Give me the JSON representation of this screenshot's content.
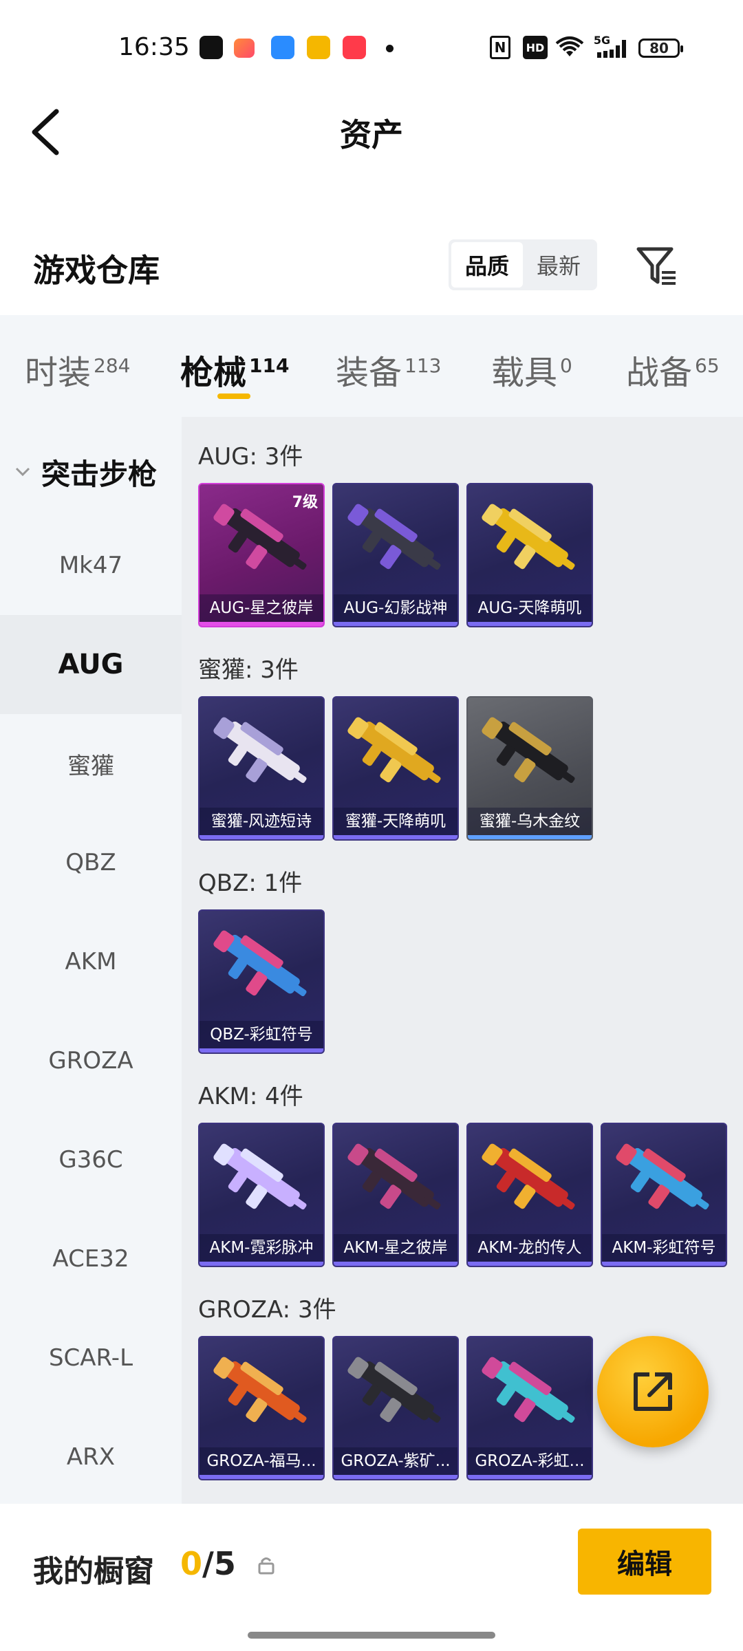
{
  "status_bar": {
    "time": "16:35",
    "network": "5G",
    "hd": "HD",
    "nfc": "N",
    "battery": "80"
  },
  "header": {
    "title": "资产",
    "back_icon": "back-arrow-icon"
  },
  "warehouse": {
    "title": "游戏仓库",
    "sort_options": [
      "品质",
      "最新"
    ],
    "sort_selected": "品质",
    "filter_icon": "filter-icon"
  },
  "tabs": [
    {
      "label": "时装",
      "count": "284"
    },
    {
      "label": "枪械",
      "count": "114"
    },
    {
      "label": "装备",
      "count": "113"
    },
    {
      "label": "载具",
      "count": "0"
    },
    {
      "label": "战备",
      "count": "65"
    }
  ],
  "active_tab": "枪械",
  "sidebar": {
    "category": "突击步枪",
    "items": [
      "Mk47",
      "AUG",
      "蜜獾",
      "QBZ",
      "AKM",
      "GROZA",
      "G36C",
      "ACE32",
      "SCAR-L",
      "ARX"
    ],
    "selected": "AUG"
  },
  "groups": [
    {
      "title": "AUG: 3件",
      "items": [
        {
          "label": "AUG-星之彼岸",
          "level": "7级",
          "rarity": "purple",
          "colors": [
            "#2a2030",
            "#d04aa0"
          ]
        },
        {
          "label": "AUG-幻影战神",
          "rarity": "blue",
          "colors": [
            "#3a3a48",
            "#7a5ad8"
          ]
        },
        {
          "label": "AUG-天降萌叽",
          "rarity": "blue",
          "colors": [
            "#e8b818",
            "#f0d060"
          ]
        }
      ]
    },
    {
      "title": "蜜獾: 3件",
      "items": [
        {
          "label": "蜜獾-风迹短诗",
          "rarity": "blue",
          "colors": [
            "#e8e4f0",
            "#a8a0d8"
          ]
        },
        {
          "label": "蜜獾-天降萌叽",
          "rarity": "blue",
          "colors": [
            "#e0a820",
            "#f0c850"
          ]
        },
        {
          "label": "蜜獾-乌木金纹",
          "rarity": "gray",
          "colors": [
            "#1e1e22",
            "#c8a040"
          ]
        }
      ]
    },
    {
      "title": "QBZ: 1件",
      "items": [
        {
          "label": "QBZ-彩虹符号",
          "rarity": "blue",
          "colors": [
            "#3a8ae0",
            "#e04a8a"
          ]
        }
      ]
    },
    {
      "title": "AKM: 4件",
      "items": [
        {
          "label": "AKM-霓彩脉冲",
          "rarity": "blue",
          "colors": [
            "#c8b0ff",
            "#e0e0ff"
          ]
        },
        {
          "label": "AKM-星之彼岸",
          "rarity": "blue",
          "colors": [
            "#3a2838",
            "#c84a8a"
          ]
        },
        {
          "label": "AKM-龙的传人",
          "rarity": "blue",
          "colors": [
            "#c82a2a",
            "#f0b030"
          ]
        },
        {
          "label": "AKM-彩虹符号",
          "rarity": "blue",
          "colors": [
            "#3aa0e0",
            "#e04a6a"
          ]
        }
      ]
    },
    {
      "title": "GROZA: 3件",
      "items": [
        {
          "label": "GROZA-福马...",
          "rarity": "blue",
          "colors": [
            "#e05a20",
            "#f0b050"
          ]
        },
        {
          "label": "GROZA-紫矿...",
          "rarity": "blue",
          "colors": [
            "#2a2a30",
            "#8a8a90"
          ]
        },
        {
          "label": "GROZA-彩虹...",
          "rarity": "blue",
          "colors": [
            "#40c0d0",
            "#d04a9a"
          ]
        }
      ]
    }
  ],
  "fab": {
    "icon": "share-icon"
  },
  "showcase": {
    "label": "我的橱窗",
    "current": "0",
    "total": "/5",
    "lock_icon": "lock-icon",
    "edit_label": "编辑"
  }
}
